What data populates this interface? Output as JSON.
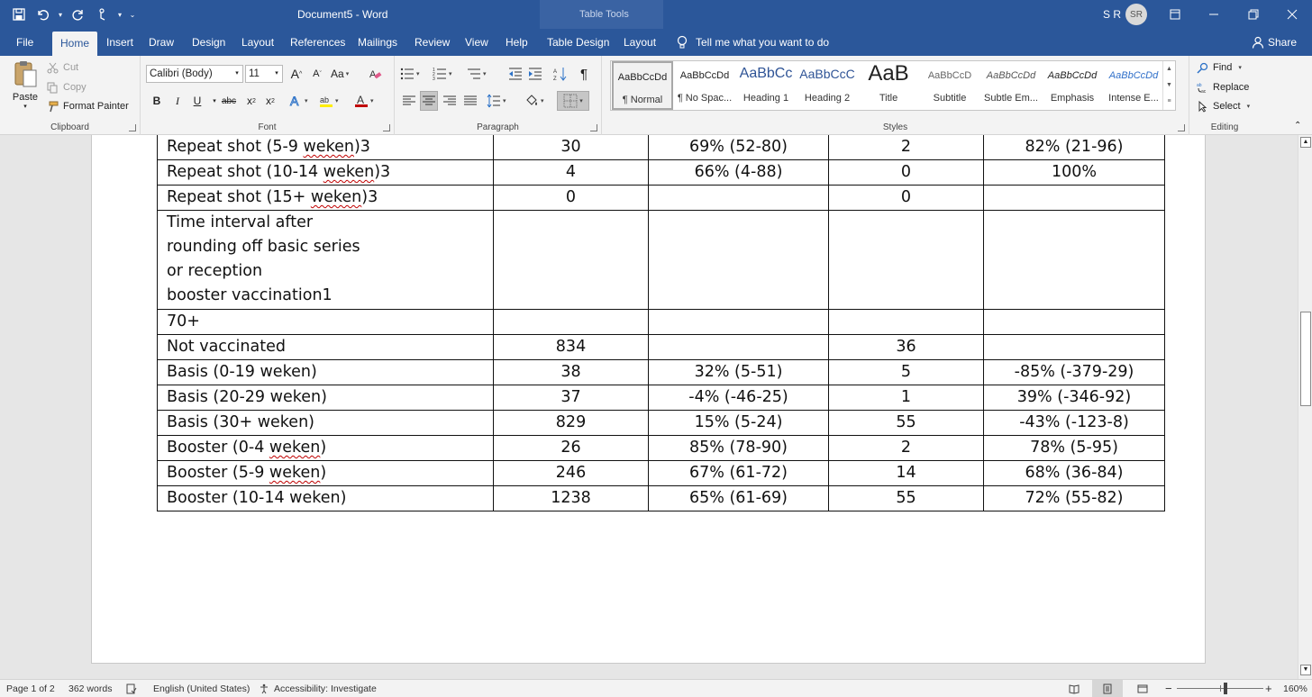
{
  "title_bar": {
    "document_title": "Document5  -  Word",
    "contextual_label": "Table Tools",
    "user_initials": "S R",
    "avatar_text": "SR"
  },
  "tabs": [
    "File",
    "Home",
    "Insert",
    "Draw",
    "Design",
    "Layout",
    "References",
    "Mailings",
    "Review",
    "View",
    "Help",
    "Table Design",
    "Layout"
  ],
  "tell_me": "Tell me what you want to do",
  "share": "Share",
  "ribbon": {
    "clipboard": {
      "paste": "Paste",
      "cut": "Cut",
      "copy": "Copy",
      "format_painter": "Format Painter",
      "label": "Clipboard"
    },
    "font": {
      "font_name": "Calibri (Body)",
      "font_size": "11",
      "grow": "A",
      "shrink": "A",
      "change_case": "Aa",
      "bold": "B",
      "italic": "I",
      "underline": "U",
      "strike": "abc",
      "subscript": "x",
      "superscript": "x",
      "label": "Font"
    },
    "paragraph": {
      "pilcrow": "¶",
      "label": "Paragraph"
    },
    "styles": {
      "label": "Styles",
      "items": [
        {
          "sample": "AaBbCcDd",
          "name": "¶ Normal"
        },
        {
          "sample": "AaBbCcDd",
          "name": "¶ No Spac..."
        },
        {
          "sample": "AaBbCc",
          "name": "Heading 1"
        },
        {
          "sample": "AaBbCcC",
          "name": "Heading 2"
        },
        {
          "sample": "AaB",
          "name": "Title"
        },
        {
          "sample": "AaBbCcD",
          "name": "Subtitle"
        },
        {
          "sample": "AaBbCcDd",
          "name": "Subtle Em..."
        },
        {
          "sample": "AaBbCcDd",
          "name": "Emphasis"
        },
        {
          "sample": "AaBbCcDd",
          "name": "Intense E..."
        }
      ]
    },
    "editing": {
      "find": "Find",
      "replace": "Replace",
      "select": "Select",
      "label": "Editing"
    }
  },
  "table": {
    "rows": [
      [
        "Repeat shot (5-9 weken)3",
        "30",
        "69% (52-80)",
        "2",
        "82% (21-96)"
      ],
      [
        "Repeat shot (10-14 weken)3",
        "4",
        "66% (4-88)",
        "0",
        "100%"
      ],
      [
        "Repeat shot (15+ weken)3",
        "0",
        "",
        "0",
        ""
      ],
      [
        "Time interval after\nrounding off basic series\nor reception\nbooster vaccination1",
        "",
        "",
        "",
        ""
      ],
      [
        "70+",
        "",
        "",
        "",
        ""
      ],
      [
        "Not vaccinated",
        "834",
        "",
        "36",
        ""
      ],
      [
        "Basis (0-19 weken)",
        "38",
        "32% (5-51)",
        "5",
        "-85% (-379-29)"
      ],
      [
        "Basis (20-29 weken)",
        "37",
        "-4% (-46-25)",
        "1",
        "39% (-346-92)"
      ],
      [
        "Basis (30+ weken)",
        "829",
        "15% (5-24)",
        "55",
        "-43% (-123-8)"
      ],
      [
        "Booster (0-4 weken)",
        "26",
        "85% (78-90)",
        "2",
        "78% (5-95)"
      ],
      [
        "Booster (5-9 weken)",
        "246",
        "67% (61-72)",
        "14",
        "68% (36-84)"
      ],
      [
        "Booster (10-14 weken)",
        "1238",
        "65% (61-69)",
        "55",
        "72% (55-82)"
      ]
    ]
  },
  "status_bar": {
    "page": "Page 1 of 2",
    "words": "362 words",
    "language": "English (United States)",
    "accessibility": "Accessibility: Investigate",
    "zoom": "160%"
  },
  "colors": {
    "title_bar": "#2b579a",
    "ribbon": "#f3f3f3",
    "document_bg": "#e6e6e6"
  }
}
